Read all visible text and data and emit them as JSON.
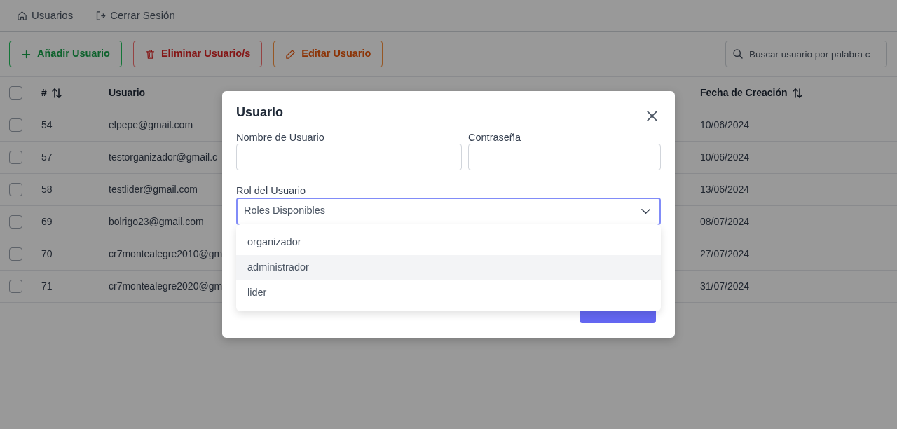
{
  "nav": [
    {
      "kind": "home",
      "label": "Usuarios"
    },
    {
      "kind": "logout",
      "label": "Cerrar Sesión"
    }
  ],
  "actions": [
    {
      "kind": "add",
      "label": "Añadir Usuario"
    },
    {
      "kind": "delete",
      "label": "Eliminar Usuario/s"
    },
    {
      "kind": "edit",
      "label": "Editar Usuario"
    }
  ],
  "search": {
    "placeholder": "Buscar usuario por palabra c"
  },
  "table": {
    "header_checked": false,
    "columns": [
      {
        "label": "#",
        "sortable": true
      },
      {
        "label": "Usuario",
        "sortable": false
      },
      {
        "label": "Fecha de Creación",
        "sortable": true
      }
    ],
    "rows": [
      {
        "checked": false,
        "cells": [
          "54",
          "elpepe@gmail.com",
          "10/06/2024"
        ]
      },
      {
        "checked": false,
        "cells": [
          "57",
          "testorganizador@gmail.c",
          "10/06/2024"
        ]
      },
      {
        "checked": false,
        "cells": [
          "58",
          "testlider@gmail.com",
          "13/06/2024"
        ]
      },
      {
        "checked": false,
        "cells": [
          "69",
          "bolrigo23@gmail.com",
          "08/07/2024"
        ]
      },
      {
        "checked": false,
        "cells": [
          "70",
          "cr7montealegre2010@gm",
          "27/07/2024"
        ]
      },
      {
        "checked": false,
        "cells": [
          "71",
          "cr7montealegre2020@gm",
          "31/07/2024"
        ]
      }
    ]
  },
  "modal": {
    "title": "Usuario",
    "fields": [
      {
        "label": "Nombre de Usuario"
      },
      {
        "label": "Contraseña"
      }
    ],
    "select": {
      "label": "Rol del Usuario",
      "value": "Roles Disponibles",
      "expanded": true,
      "options": [
        {
          "label": "organizador",
          "highlighted": false
        },
        {
          "label": "administrador",
          "highlighted": true
        },
        {
          "label": "lider",
          "highlighted": false
        }
      ]
    }
  }
}
